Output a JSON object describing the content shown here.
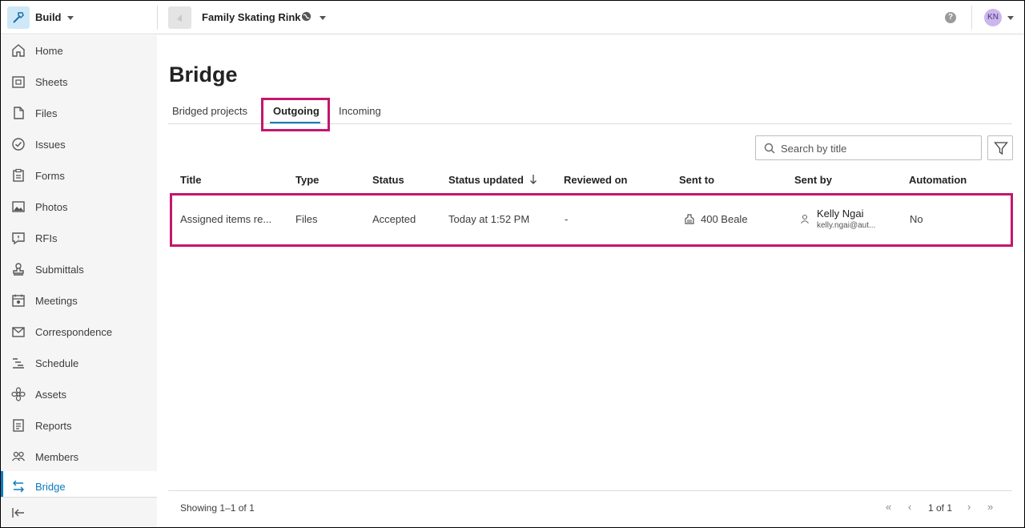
{
  "app": {
    "name": "Build"
  },
  "project": {
    "name": "Family Skating Rink"
  },
  "user": {
    "initials": "KN"
  },
  "sidebar": {
    "items": [
      {
        "label": "Home",
        "icon": "home-icon"
      },
      {
        "label": "Sheets",
        "icon": "sheets-icon"
      },
      {
        "label": "Files",
        "icon": "files-icon"
      },
      {
        "label": "Issues",
        "icon": "issues-icon"
      },
      {
        "label": "Forms",
        "icon": "forms-icon"
      },
      {
        "label": "Photos",
        "icon": "photos-icon"
      },
      {
        "label": "RFIs",
        "icon": "rfis-icon"
      },
      {
        "label": "Submittals",
        "icon": "submittals-icon"
      },
      {
        "label": "Meetings",
        "icon": "meetings-icon"
      },
      {
        "label": "Correspondence",
        "icon": "correspondence-icon"
      },
      {
        "label": "Schedule",
        "icon": "schedule-icon"
      },
      {
        "label": "Assets",
        "icon": "assets-icon"
      },
      {
        "label": "Reports",
        "icon": "reports-icon"
      },
      {
        "label": "Members",
        "icon": "members-icon"
      },
      {
        "label": "Bridge",
        "icon": "bridge-icon",
        "active": true
      }
    ]
  },
  "page": {
    "title": "Bridge",
    "tabs": [
      {
        "label": "Bridged projects"
      },
      {
        "label": "Outgoing",
        "active": true
      },
      {
        "label": "Incoming"
      }
    ]
  },
  "search": {
    "placeholder": "Search by title"
  },
  "table": {
    "columns": [
      "Title",
      "Type",
      "Status",
      "Status updated",
      "Reviewed on",
      "Sent to",
      "Sent by",
      "Automation"
    ],
    "rows": [
      {
        "title": "Assigned items re...",
        "type": "Files",
        "status": "Accepted",
        "status_updated": "Today at 1:52 PM",
        "reviewed_on": "-",
        "sent_to": "400 Beale",
        "sent_by_name": "Kelly Ngai",
        "sent_by_email": "kelly.ngai@aut...",
        "automation": "No"
      }
    ]
  },
  "footer": {
    "showing": "Showing 1–1 of 1",
    "page_info": "1 of 1"
  },
  "colors": {
    "accent": "#0a7bbd",
    "highlight": "#c4166f"
  }
}
